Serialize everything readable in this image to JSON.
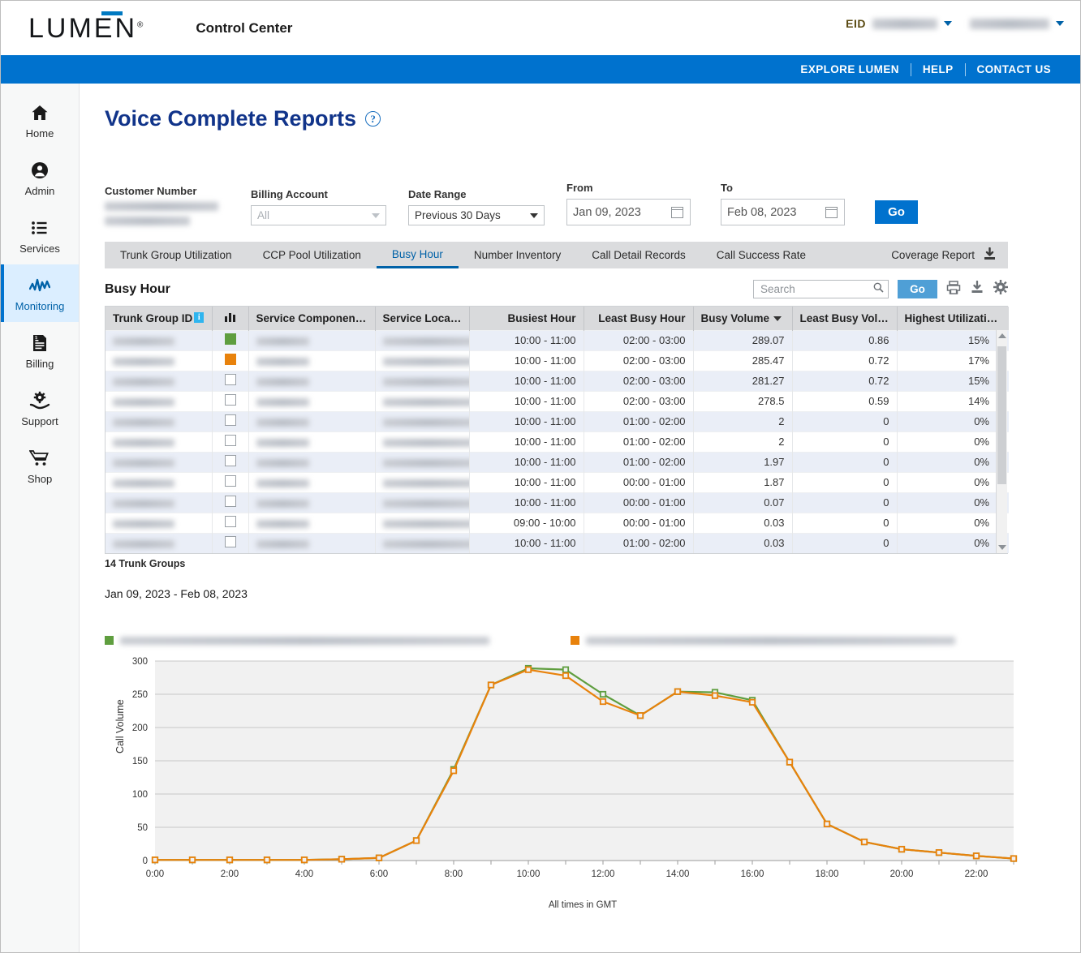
{
  "header": {
    "brand": "LUMEN",
    "brand_registered": "®",
    "app_title": "Control Center",
    "eid_label": "EID",
    "eid_value_redacted": "1111762725",
    "account_redacted": "mathcontrolesk",
    "nav_links": [
      "EXPLORE LUMEN",
      "HELP",
      "CONTACT US"
    ]
  },
  "sidebar": {
    "items": [
      {
        "label": "Home",
        "icon": "home-icon",
        "active": false
      },
      {
        "label": "Admin",
        "icon": "user-circle-icon",
        "active": false
      },
      {
        "label": "Services",
        "icon": "list-icon",
        "active": false
      },
      {
        "label": "Monitoring",
        "icon": "pulse-icon",
        "active": true
      },
      {
        "label": "Billing",
        "icon": "invoice-icon",
        "active": false
      },
      {
        "label": "Support",
        "icon": "gear-hand-icon",
        "active": false
      },
      {
        "label": "Shop",
        "icon": "cart-icon",
        "active": false
      }
    ]
  },
  "page": {
    "title": "Voice Complete Reports",
    "help_glyph": "?"
  },
  "filters": {
    "customer_number": {
      "label": "Customer Number",
      "value_redacted": "1-2Z16GG8L3FTE SERVICES"
    },
    "billing_account": {
      "label": "Billing Account",
      "value": "All"
    },
    "date_range": {
      "label": "Date Range",
      "value": "Previous 30 Days"
    },
    "from": {
      "label": "From",
      "value": "Jan 09, 2023"
    },
    "to": {
      "label": "To",
      "value": "Feb 08, 2023"
    },
    "go_label": "Go"
  },
  "tabs": {
    "items": [
      {
        "label": "Trunk Group Utilization",
        "active": false
      },
      {
        "label": "CCP Pool Utilization",
        "active": false
      },
      {
        "label": "Busy Hour",
        "active": true
      },
      {
        "label": "Number Inventory",
        "active": false
      },
      {
        "label": "Call Detail Records",
        "active": false
      },
      {
        "label": "Call Success Rate",
        "active": false
      }
    ],
    "coverage_report_label": "Coverage Report"
  },
  "toolbar": {
    "section_title": "Busy Hour",
    "search_placeholder": "Search",
    "search_value": "",
    "go_label": "Go",
    "icons": [
      "print-icon",
      "download-icon",
      "gear-icon"
    ]
  },
  "table": {
    "columns": [
      {
        "key": "trunk_group_id",
        "label": "Trunk Group ID",
        "info_icon": true,
        "align": "left"
      },
      {
        "key": "chart_toggle",
        "label": "",
        "icon": "bar-chart-icon",
        "align": "center"
      },
      {
        "key": "service_component",
        "label": "Service Component (S…",
        "align": "left"
      },
      {
        "key": "service_location",
        "label": "Service Location",
        "align": "left"
      },
      {
        "key": "busiest_hour",
        "label": "Busiest Hour",
        "align": "right"
      },
      {
        "key": "least_busy_hour",
        "label": "Least Busy Hour",
        "align": "right"
      },
      {
        "key": "busy_volume",
        "label": "Busy Volume",
        "align": "right",
        "sorted": "desc"
      },
      {
        "key": "least_busy_volume",
        "label": "Least Busy Volu…",
        "align": "right"
      },
      {
        "key": "highest_utilization",
        "label": "Highest Utilizatio…",
        "align": "right"
      }
    ],
    "rows": [
      {
        "trunk_group_id": "0000 00000",
        "checkbox": "green",
        "service_component": "BLTPU00007",
        "service_location": "UNIT 9-12, POUNDS…",
        "busiest_hour": "10:00 - 11:00",
        "least_busy_hour": "02:00 - 03:00",
        "busy_volume": "289.07",
        "least_busy_volume": "0.86",
        "highest_utilization": "15%"
      },
      {
        "trunk_group_id": "0000 00017",
        "checkbox": "orange",
        "service_component": "BLTPU0064H",
        "service_location": "UNIT 9-12, POUNDS…",
        "busiest_hour": "10:00 - 11:00",
        "least_busy_hour": "02:00 - 03:00",
        "busy_volume": "285.47",
        "least_busy_volume": "0.72",
        "highest_utilization": "17%"
      },
      {
        "trunk_group_id": "0000 00024",
        "checkbox": "empty",
        "service_component": "0BEIU76286",
        "service_location": "BAS CORONATION …",
        "busiest_hour": "10:00 - 11:00",
        "least_busy_hour": "02:00 - 03:00",
        "busy_volume": "281.27",
        "least_busy_volume": "0.72",
        "highest_utilization": "15%"
      },
      {
        "trunk_group_id": "0000 00031",
        "checkbox": "empty",
        "service_component": "0BEIU73014",
        "service_location": "BAS CORONATION …",
        "busiest_hour": "10:00 - 11:00",
        "least_busy_hour": "02:00 - 03:00",
        "busy_volume": "278.5",
        "least_busy_volume": "0.59",
        "highest_utilization": "14%"
      },
      {
        "trunk_group_id": "0000 00025",
        "checkbox": "empty",
        "service_component": "0BEIU79216",
        "service_location": "BAS CORONATION …",
        "busiest_hour": "10:00 - 11:00",
        "least_busy_hour": "01:00 - 02:00",
        "busy_volume": "2",
        "least_busy_volume": "0",
        "highest_utilization": "0%"
      },
      {
        "trunk_group_id": "0000 00489",
        "checkbox": "empty",
        "service_component": "0BEIU79123",
        "service_location": "BAS CORONATION …",
        "busiest_hour": "10:00 - 11:00",
        "least_busy_hour": "01:00 - 02:00",
        "busy_volume": "2",
        "least_busy_volume": "0",
        "highest_utilization": "0%"
      },
      {
        "trunk_group_id": "0000 00080",
        "checkbox": "empty",
        "service_component": "BLTPU0868A",
        "service_location": "UNIT 9-12, POUNDS…",
        "busiest_hour": "10:00 - 11:00",
        "least_busy_hour": "01:00 - 02:00",
        "busy_volume": "1.97",
        "least_busy_volume": "0",
        "highest_utilization": "0%"
      },
      {
        "trunk_group_id": "0000 00029",
        "checkbox": "empty",
        "service_component": "BLTPU00821",
        "service_location": "UNIT 9-12, POUNDS…",
        "busiest_hour": "10:00 - 11:00",
        "least_busy_hour": "00:00 - 01:00",
        "busy_volume": "1.87",
        "least_busy_volume": "0",
        "highest_utilization": "0%"
      },
      {
        "trunk_group_id": "0000 00082",
        "checkbox": "empty",
        "service_component": "0BEIU73488",
        "service_location": "BAS CORONATION …",
        "busiest_hour": "10:00 - 11:00",
        "least_busy_hour": "00:00 - 01:00",
        "busy_volume": "0.07",
        "least_busy_volume": "0",
        "highest_utilization": "0%"
      },
      {
        "trunk_group_id": "000000 193",
        "checkbox": "empty",
        "service_component": "BL2HH10017",
        "service_location": "UNIT 9-12, POUNDS…",
        "busiest_hour": "09:00 - 10:00",
        "least_busy_hour": "00:00 - 01:00",
        "busy_volume": "0.03",
        "least_busy_volume": "0",
        "highest_utilization": "0%"
      },
      {
        "trunk_group_id": "000000 184",
        "checkbox": "empty",
        "service_component": "BL2AH18873",
        "service_location": "UNIT 11, WATERS B…",
        "busiest_hour": "10:00 - 11:00",
        "least_busy_hour": "01:00 - 02:00",
        "busy_volume": "0.03",
        "least_busy_volume": "0",
        "highest_utilization": "0%"
      }
    ],
    "footer_count": "14 Trunk Groups"
  },
  "report_range": "Jan 09, 2023 - Feb 08, 2023",
  "chart_data": {
    "type": "line",
    "title": "",
    "xlabel": "",
    "ylabel": "Call Volume",
    "footnote": "All times in GMT",
    "ylim": [
      0,
      300
    ],
    "yticks": [
      0,
      50,
      100,
      150,
      200,
      250,
      300
    ],
    "grid": true,
    "legend_position": "top",
    "x": [
      "0:00",
      "1:00",
      "2:00",
      "3:00",
      "4:00",
      "5:00",
      "6:00",
      "7:00",
      "8:00",
      "9:00",
      "10:00",
      "11:00",
      "12:00",
      "13:00",
      "14:00",
      "15:00",
      "16:00",
      "17:00",
      "18:00",
      "19:00",
      "20:00",
      "21:00",
      "22:00",
      "23:00"
    ],
    "xtick_labels": [
      "0:00",
      "2:00",
      "4:00",
      "6:00",
      "8:00",
      "10:00",
      "12:00",
      "14:00",
      "16:00",
      "18:00",
      "20:00",
      "22:00"
    ],
    "series": [
      {
        "name_redacted": "0000 00000 unit 9-12, powergate business park, volt avenue, london, kid no10 8pw, gb",
        "color": "#5f9e3f",
        "values": [
          1,
          1,
          1,
          1,
          1,
          2,
          4,
          30,
          137,
          264,
          289,
          287,
          250,
          218,
          254,
          253,
          241,
          148,
          55,
          28,
          17,
          12,
          7,
          3
        ]
      },
      {
        "name_redacted": "0000 00017 unit 9-12, powergate business park, volt avenue, london, kid no10 8pw, gb",
        "color": "#e8820c",
        "values": [
          1,
          1,
          1,
          1,
          1,
          2,
          4,
          30,
          135,
          264,
          287,
          278,
          239,
          218,
          254,
          248,
          238,
          148,
          55,
          28,
          17,
          12,
          7,
          3
        ]
      }
    ]
  }
}
